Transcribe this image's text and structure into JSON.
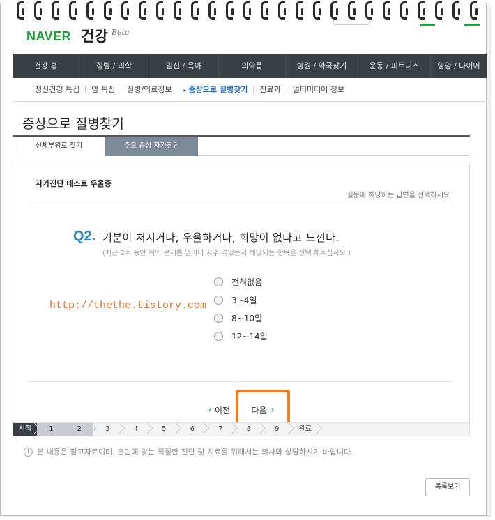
{
  "header": {
    "brand": "NAVER",
    "service": "건강",
    "beta": "Beta"
  },
  "gnb": [
    {
      "label": "건강 홈",
      "active": false
    },
    {
      "label": "질병 / 의학",
      "active": true
    },
    {
      "label": "임신 / 육아",
      "active": false
    },
    {
      "label": "의약품",
      "active": false
    },
    {
      "label": "병원 / 약국찾기",
      "active": false
    },
    {
      "label": "운동 / 피트니스",
      "active": false
    },
    {
      "label": "영양 / 다이어",
      "active": false
    }
  ],
  "lnb": [
    {
      "label": "정신건강 특집"
    },
    {
      "label": "암 특집"
    },
    {
      "label": "질병/의료정보"
    },
    {
      "label": "증상으로 질병찾기",
      "active": true
    },
    {
      "label": "진료과"
    },
    {
      "label": "멀티미디어 정보"
    }
  ],
  "page_title": "증상으로 질병찾기",
  "subtabs": [
    {
      "label": "신체부위로 찾기",
      "active": false
    },
    {
      "label": "주요 증상 자가진단",
      "active": true
    }
  ],
  "panel": {
    "title": "자가진단 테스트 우울증",
    "hint": "질문에 해당하는 답변을 선택하세요"
  },
  "question": {
    "number": "Q2.",
    "text": "기분이 처지거나, 우울하거나, 희망이 없다고 느낀다.",
    "sub": "(최근 2주 동안 위의 문제를 얼마나 자주 겪었는지 해당되는 항목을 선택 해주십시오.)"
  },
  "options": [
    "전혀없음",
    "3~4일",
    "8~10일",
    "12~14일"
  ],
  "watermark": "http://thethe.tistory.com",
  "nav": {
    "prev": "이전",
    "next": "다음"
  },
  "progress": {
    "start": "시작",
    "steps": [
      "1",
      "2",
      "3",
      "4",
      "5",
      "6",
      "7",
      "8",
      "9",
      "완료"
    ],
    "completed": 2
  },
  "notice": "본 내용은 참고자료이며, 본인에 맞는 적절한 진단 및 치료를 위해서는 의사와 상담하시기 바랍니다.",
  "list_button": "목록보기",
  "colors": {
    "brand_green": "#1ba23a",
    "accent_blue": "#2a87c8",
    "highlight_orange": "#f47c20"
  }
}
